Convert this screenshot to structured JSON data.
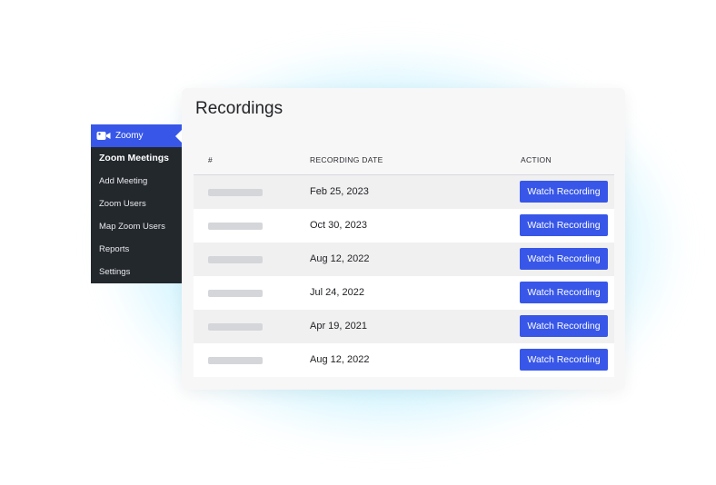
{
  "sidebar": {
    "header": {
      "label": "Zoomy",
      "icon": "video-camera-icon"
    },
    "items": [
      {
        "label": "Zoom Meetings"
      },
      {
        "label": "Add Meeting"
      },
      {
        "label": "Zoom Users"
      },
      {
        "label": "Map Zoom Users"
      },
      {
        "label": "Reports"
      },
      {
        "label": "Settings"
      }
    ]
  },
  "recordings": {
    "title": "Recordings",
    "columns": {
      "num": "#",
      "date": "RECORDING DATE",
      "action": "ACTION"
    },
    "rows": [
      {
        "date": "Feb 25, 2023",
        "action": "Watch Recording"
      },
      {
        "date": "Oct 30, 2023",
        "action": "Watch Recording"
      },
      {
        "date": "Aug 12, 2022",
        "action": "Watch Recording"
      },
      {
        "date": "Jul 24, 2022",
        "action": "Watch Recording"
      },
      {
        "date": "Apr 19, 2021",
        "action": "Watch Recording"
      },
      {
        "date": "Aug 12, 2022",
        "action": "Watch Recording"
      }
    ]
  },
  "colors": {
    "accent": "#3857e8",
    "sidebar_bg": "#23282d",
    "glow": "#5ed6ff"
  }
}
